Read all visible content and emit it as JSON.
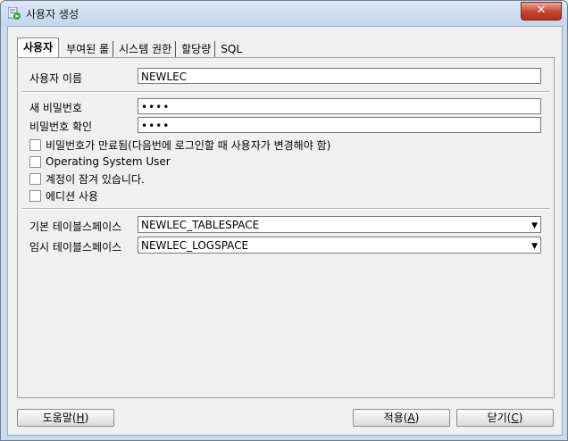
{
  "window": {
    "title": "사용자 생성",
    "close": "✕"
  },
  "tabs": [
    {
      "label": "사용자",
      "active": true
    },
    {
      "label": "부여된 롤"
    },
    {
      "label": "시스템 권한"
    },
    {
      "label": "할당량"
    },
    {
      "label": "SQL"
    }
  ],
  "form": {
    "username_label": "사용자 이름",
    "username_value": "NEWLEC",
    "new_password_label": "새 비밀번호",
    "new_password_value": "••••",
    "confirm_password_label": "비밀번호 확인",
    "confirm_password_value": "••••",
    "checkboxes": [
      {
        "label": "비밀번호가 만료됨(다음번에 로그인할 때 사용자가 변경해야 함)",
        "checked": false
      },
      {
        "label": "Operating System User",
        "checked": false
      },
      {
        "label": "계정이 잠겨 있습니다.",
        "checked": false
      },
      {
        "label": "에디션 사용",
        "checked": false
      }
    ],
    "default_tablespace_label": "기본 테이블스페이스",
    "default_tablespace_value": "NEWLEC_TABLESPACE",
    "temp_tablespace_label": "임시 테이블스페이스",
    "temp_tablespace_value": "NEWLEC_LOGSPACE"
  },
  "buttons": {
    "help": {
      "text": "도움말(",
      "key": "H",
      "close": ")"
    },
    "apply": {
      "text": "적용(",
      "key": "A",
      "close": ")"
    },
    "close": {
      "text": "닫기(",
      "key": "C",
      "close": ")"
    }
  },
  "colors": {
    "close_button": "#c4432b",
    "titlebar": "#c9dbee"
  }
}
